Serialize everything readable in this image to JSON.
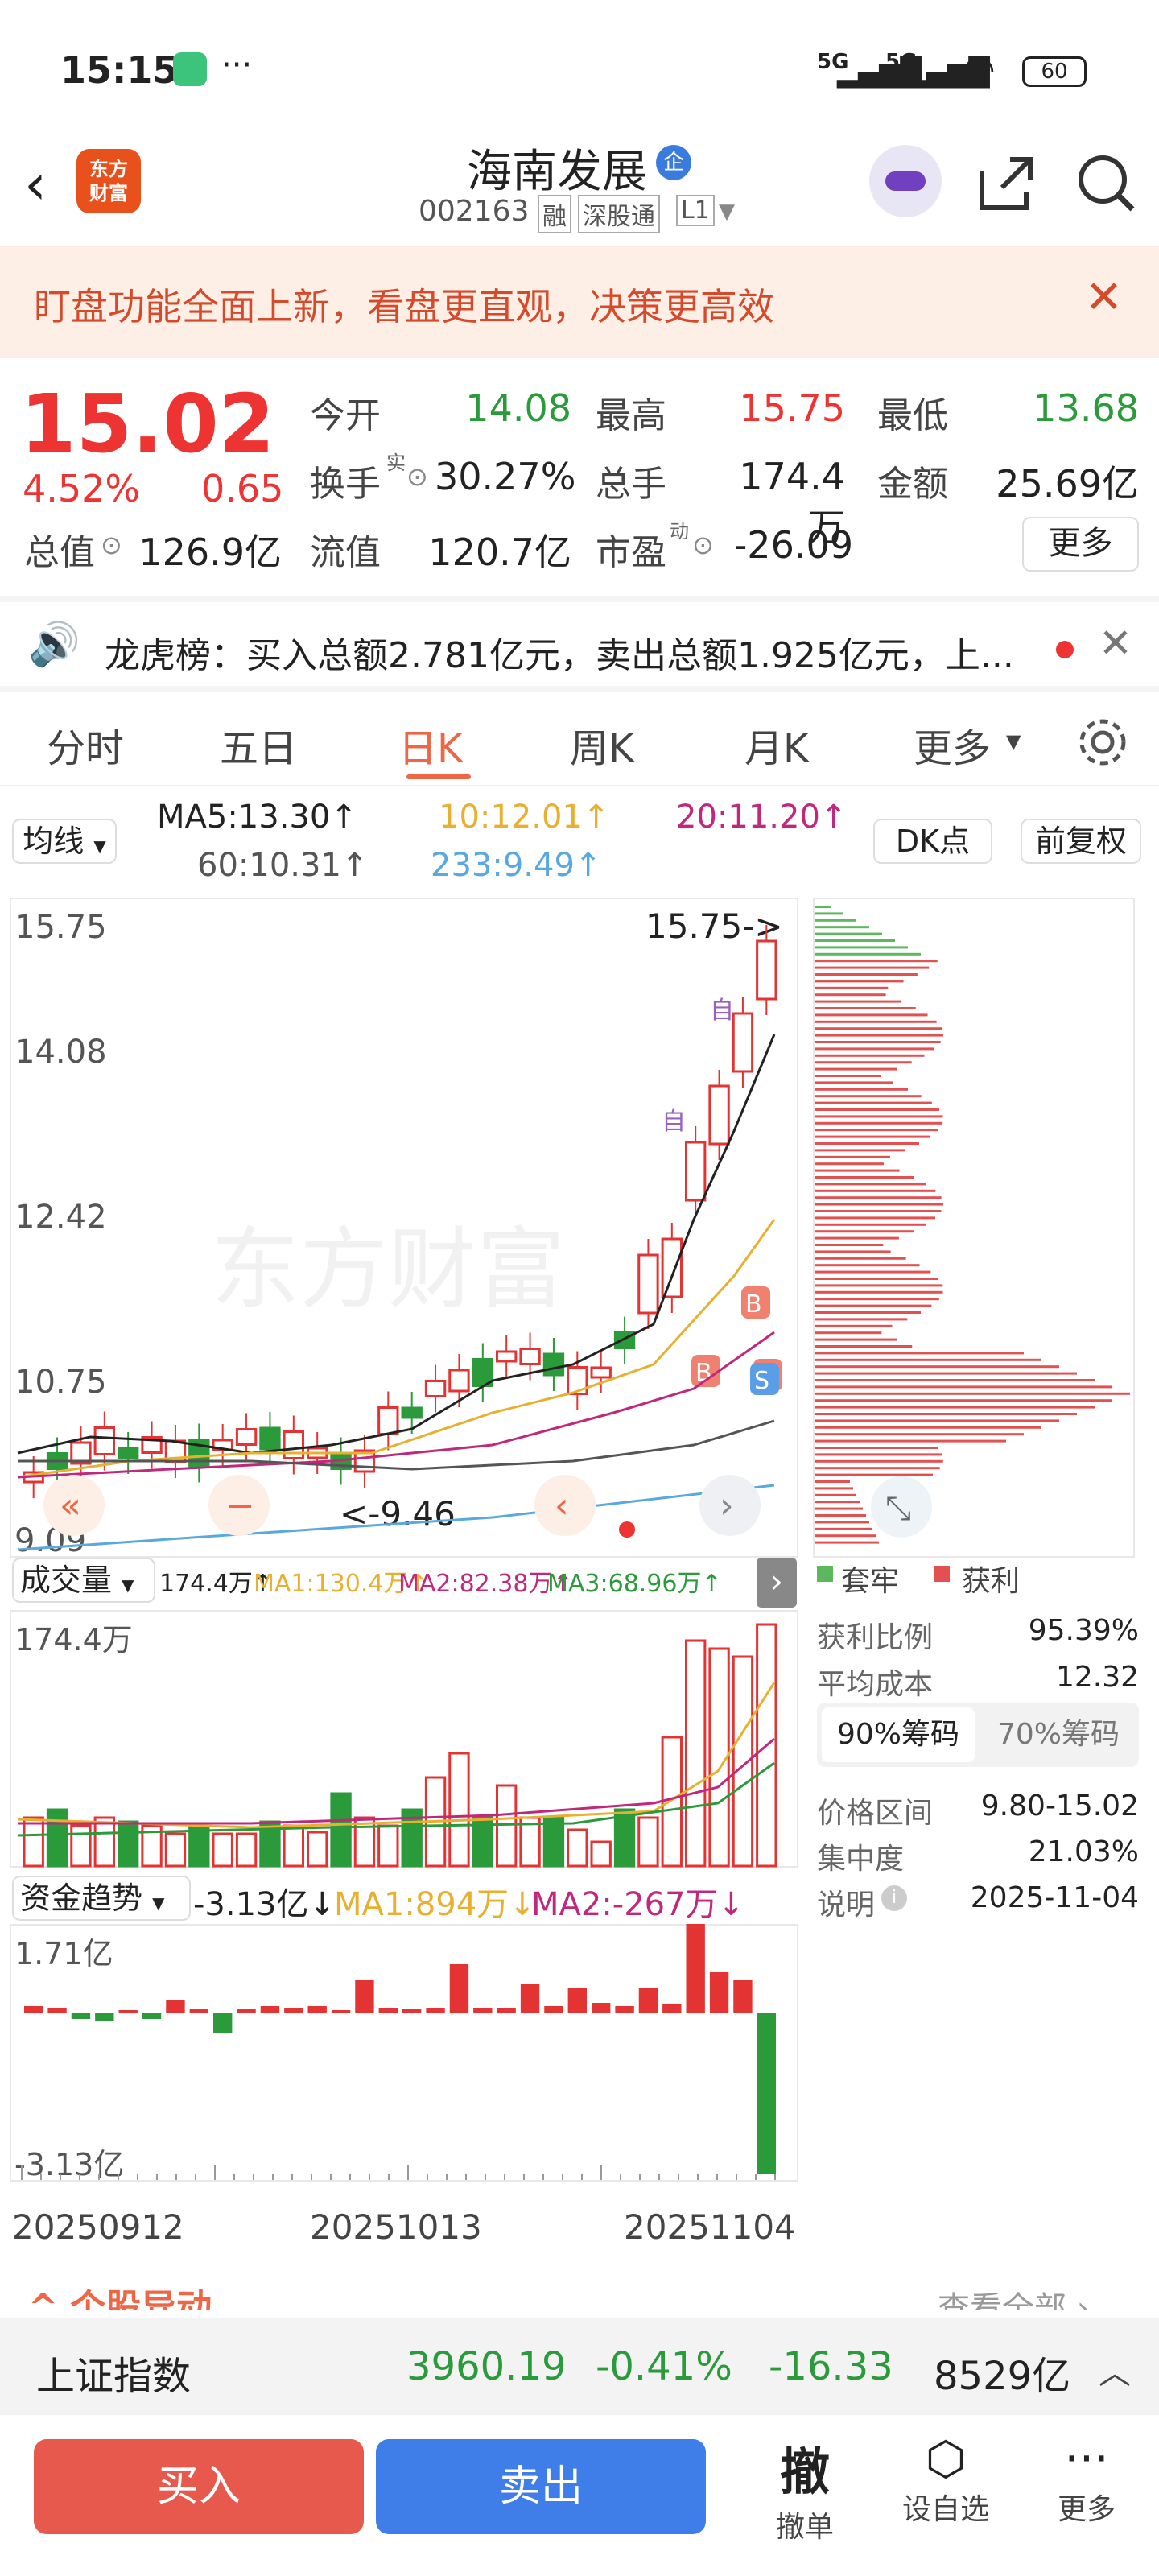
{
  "status": {
    "time": "15:15",
    "network1": "5G",
    "network2": "5G",
    "battery": "60"
  },
  "header": {
    "title": "海南发展",
    "badge": "企",
    "code": "002163",
    "tags": [
      "融",
      "深股通",
      "L1"
    ],
    "logo_text": "东方\n财富"
  },
  "banner": {
    "text": "盯盘功能全面上新，看盘更直观，决策更高效"
  },
  "quote": {
    "price": "15.02",
    "change_pct": "4.52%",
    "change": "0.65",
    "open_label": "今开",
    "open": "14.08",
    "high_label": "最高",
    "high": "15.75",
    "low_label": "最低",
    "low": "13.68",
    "turnover_label": "换手",
    "turnover_sup": "实",
    "turnover": "30.27%",
    "volume_label": "总手",
    "volume": "174.4万",
    "amount_label": "金额",
    "amount": "25.69亿",
    "mktcap_label": "总值",
    "mktcap": "126.9亿",
    "float_label": "流值",
    "float": "120.7亿",
    "pe_label": "市盈",
    "pe_sup": "动",
    "pe": "-26.09",
    "more": "更多"
  },
  "lhb": {
    "text": "龙虎榜：买入总额2.781亿元，卖出总额1.925亿元，上..."
  },
  "tabs": [
    "分时",
    "五日",
    "日K",
    "周K",
    "月K",
    "更多"
  ],
  "ma": {
    "selector": "均线",
    "ma5": "MA5:13.30↑",
    "ma10": "10:12.01↑",
    "ma20": "20:11.20↑",
    "ma60": "60:10.31↑",
    "ma233": "233:9.49↑",
    "dk": "DK点",
    "adjust": "前复权"
  },
  "kline": {
    "y_labels": [
      "15.75",
      "14.08",
      "12.42",
      "10.75",
      "9.09"
    ],
    "high_note": "15.75->",
    "low_note": "<-9.46",
    "watermark": "东方财富",
    "marks": {
      "zi": "自",
      "b": "B",
      "s": "S"
    }
  },
  "chips": {
    "legend_hold": "套牢",
    "legend_profit": "获利",
    "rows": [
      {
        "label": "获利比例",
        "value": "95.39%"
      },
      {
        "label": "平均成本",
        "value": "12.32"
      }
    ],
    "tab90": "90%筹码",
    "tab70": "70%筹码",
    "rows2": [
      {
        "label": "价格区间",
        "value": "9.80-15.02"
      },
      {
        "label": "集中度",
        "value": "21.03%"
      },
      {
        "label": "说明",
        "value": "2025-11-04"
      }
    ]
  },
  "volume": {
    "selector": "成交量",
    "v": "174.4万↑",
    "ma1": "MA1:130.4万↑",
    "ma2": "MA2:82.38万↑",
    "ma3": "MA3:68.96万↑",
    "max_label": "174.4万"
  },
  "fund": {
    "selector": "资金趋势",
    "v": "-3.13亿↓",
    "ma1": "MA1:894万↓",
    "ma2": "MA2:-267万↓",
    "top": "1.71亿",
    "bottom": "-3.13亿"
  },
  "dates": [
    "20250912",
    "20251013",
    "20251104"
  ],
  "section": {
    "title": "个股异动",
    "more": "查看全部"
  },
  "index": {
    "name": "上证指数",
    "value": "3960.19",
    "pct": "-0.41%",
    "chg": "-16.33",
    "amount": "8529亿"
  },
  "actions": {
    "buy": "买入",
    "sell": "卖出",
    "cancel_icon": "撤",
    "cancel": "撤单",
    "watch": "设自选",
    "more": "更多"
  },
  "colors": {
    "up": "#e33333",
    "down": "#2a9a3a",
    "ma5": "#222222",
    "ma10": "#e8b030",
    "ma20": "#c0287c",
    "ma60": "#555555",
    "ma233": "#5aa8e0"
  }
}
